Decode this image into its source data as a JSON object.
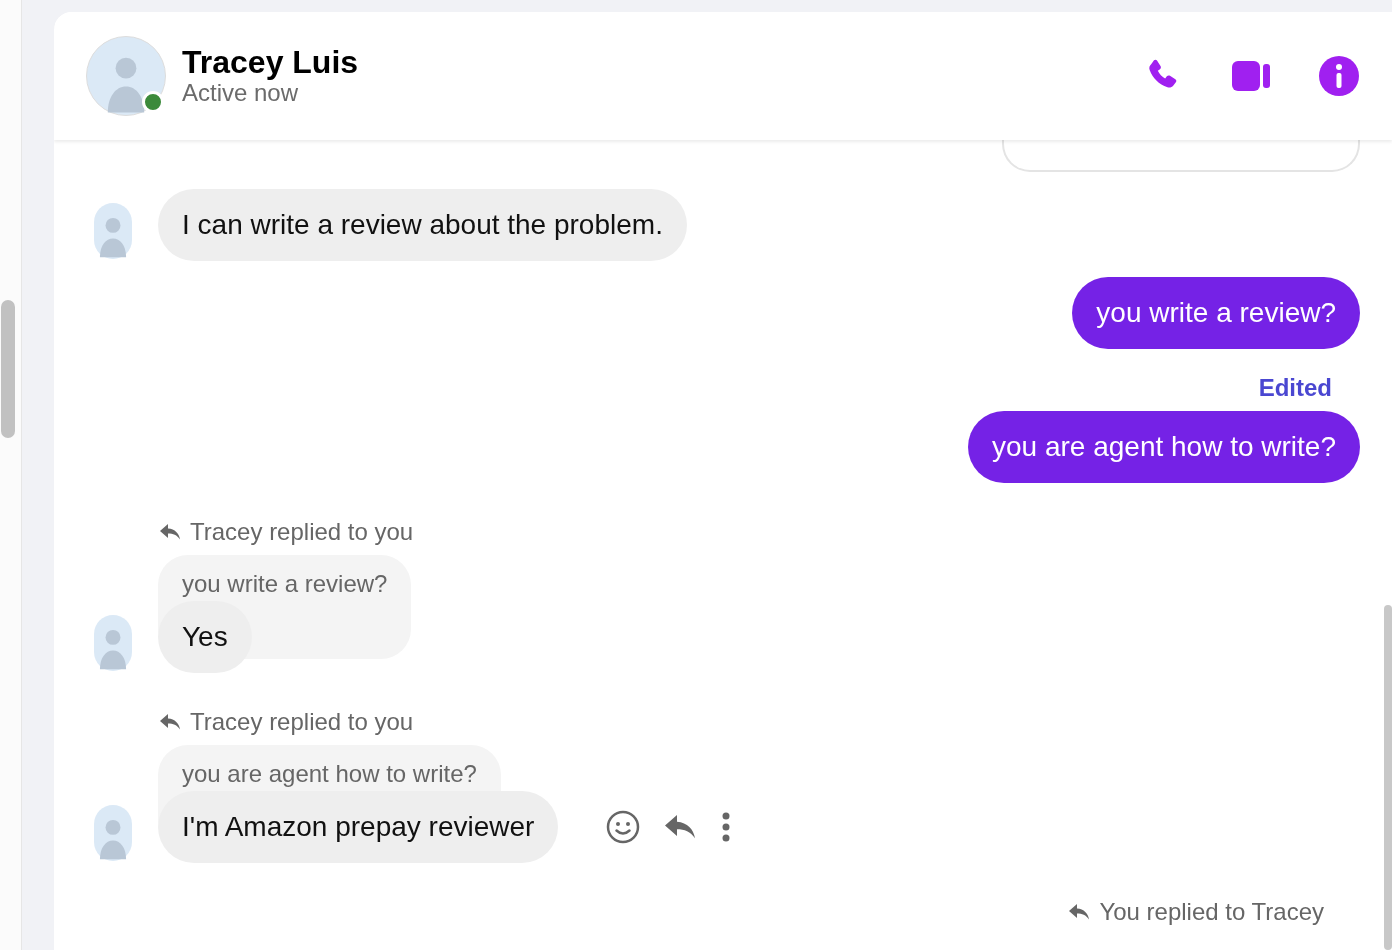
{
  "contact": {
    "name": "Tracey Luis",
    "status": "Active now",
    "online": true
  },
  "header_actions": [
    {
      "kind": "call"
    },
    {
      "kind": "video"
    },
    {
      "kind": "info"
    }
  ],
  "messages": [
    {
      "kind": "unsent"
    },
    {
      "kind": "incoming",
      "text": "I can write a review about the problem."
    },
    {
      "kind": "outgoing",
      "text": "you write a review?"
    },
    {
      "kind": "outgoing",
      "edited_label": "Edited",
      "text": "you are agent how to write?"
    },
    {
      "kind": "incoming",
      "reply_label": "Tracey replied to you",
      "quoted": "you write a review?",
      "text": "Yes"
    },
    {
      "kind": "incoming",
      "reply_label": "Tracey replied to you",
      "quoted": "you are agent how to write?",
      "text": "I'm Amazon prepay reviewer",
      "hover_actions": true
    },
    {
      "kind": "outgoing",
      "reply_label": "You replied to Tracey"
    }
  ]
}
